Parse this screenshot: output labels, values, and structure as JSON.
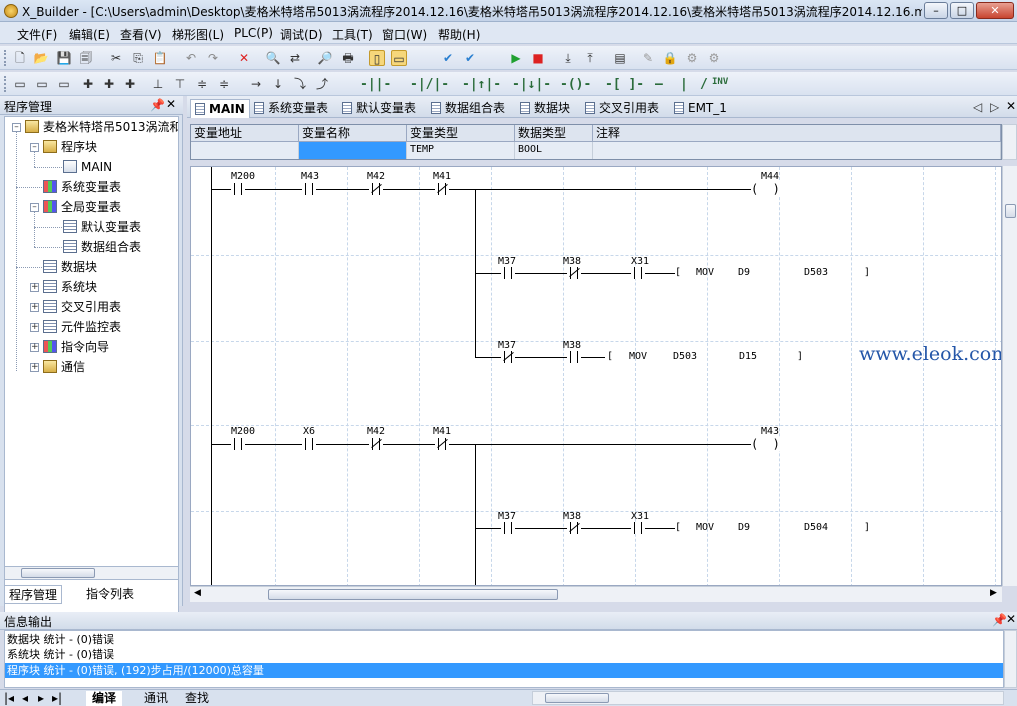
{
  "window": {
    "title": "X_Builder - [C:\\Users\\admin\\Desktop\\麦格米特塔吊5013涡流程序2014.12.16\\麦格米特塔吊5013涡流程序2014.12.16\\麦格米特塔吊5013涡流程序2014.12.16.m..."
  },
  "menu": [
    "文件(F)",
    "编辑(E)",
    "查看(V)",
    "梯形图(L)",
    "PLC(P)",
    "调试(D)",
    "工具(T)",
    "窗口(W)",
    "帮助(H)"
  ],
  "toolbar3": [
    "-||-",
    "-|/|-",
    "-|↑|-",
    "-|↓|-",
    "-()-",
    "-[ ]-",
    "—",
    "|",
    "/",
    "INV"
  ],
  "left_panel": {
    "title": "程序管理",
    "tree": [
      {
        "label": "麦格米特塔吊5013涡流和"
      },
      {
        "label": "程序块"
      },
      {
        "label": "MAIN"
      },
      {
        "label": "系统变量表"
      },
      {
        "label": "全局变量表"
      },
      {
        "label": "默认变量表"
      },
      {
        "label": "数据组合表"
      },
      {
        "label": "数据块"
      },
      {
        "label": "系统块"
      },
      {
        "label": "交叉引用表"
      },
      {
        "label": "元件监控表"
      },
      {
        "label": "指令向导"
      },
      {
        "label": "通信"
      }
    ],
    "tabs": [
      "程序管理",
      "指令列表"
    ]
  },
  "doc_tabs": [
    "MAIN",
    "系统变量表",
    "默认变量表",
    "数据组合表",
    "数据块",
    "交叉引用表",
    "EMT_1"
  ],
  "var_table": {
    "headers": [
      "变量地址",
      "变量名称",
      "变量类型",
      "数据类型",
      "注释"
    ],
    "row": [
      "",
      "",
      "TEMP",
      "BOOL",
      ""
    ]
  },
  "ladder": {
    "rung1": {
      "contacts": [
        "M200",
        "M43",
        "M42",
        "M41"
      ],
      "coil": "M44"
    },
    "branch1": {
      "contacts": [
        "M37",
        "M38",
        "X31"
      ],
      "instr": "MOV",
      "src": "D9",
      "dst": "D503"
    },
    "branch2": {
      "contacts": [
        "M37",
        "M38"
      ],
      "instr": "MOV",
      "src": "D503",
      "dst": "D15"
    },
    "rung2": {
      "contacts": [
        "M200",
        "X6",
        "M42",
        "M41"
      ],
      "coil": "M43"
    },
    "branch3": {
      "contacts": [
        "M37",
        "M38",
        "X31"
      ],
      "instr": "MOV",
      "src": "D9",
      "dst": "D504"
    },
    "watermark": "www.eleok.com"
  },
  "info": {
    "title": "信息输出",
    "lines": [
      "数据块  统计 - (0)错误",
      "系统块  统计 - (0)错误",
      "程序块  统计 - (0)错误, (192)步占用/(12000)总容量"
    ],
    "tabs": [
      "编译",
      "通讯",
      "查找"
    ]
  }
}
